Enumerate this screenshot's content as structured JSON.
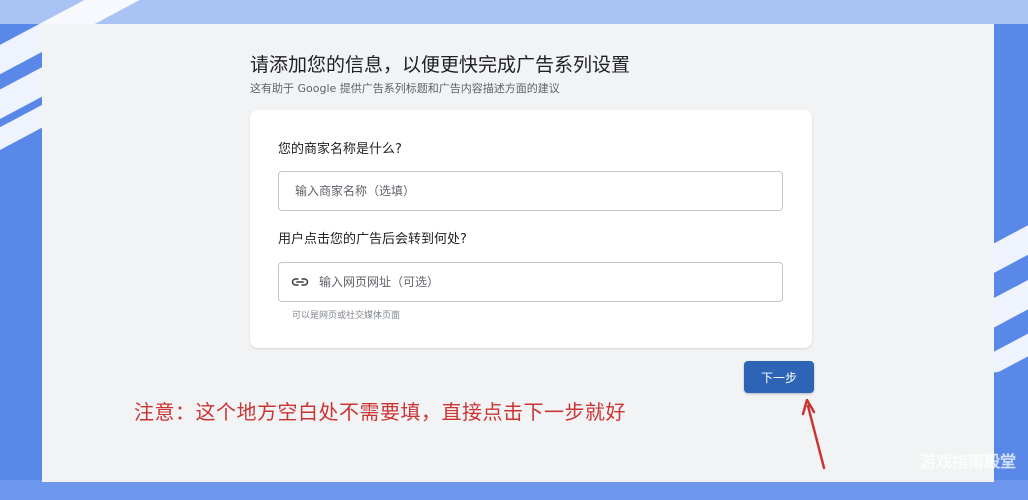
{
  "page": {
    "title": "请添加您的信息，以便更快完成广告系列设置",
    "subtitle": "这有助于 Google 提供广告系列标题和广告内容描述方面的建议"
  },
  "form": {
    "business_question": "您的商家名称是什么?",
    "business_placeholder": "输入商家名称（选填）",
    "url_question": "用户点击您的广告后会转到何处?",
    "url_placeholder": "输入网页网址（可选）",
    "url_hint": "可以是网页或社交媒体页面",
    "url_icon": "link-icon"
  },
  "actions": {
    "next_label": "下一步"
  },
  "annotation": {
    "note": "注意：这个地方空白处不需要填，直接点击下一步就好",
    "arrow_icon": "red-arrow-icon"
  },
  "watermark": "游戏指南殿堂",
  "colors": {
    "primary_button": "#2e64b6",
    "annotation_red": "#cc3333",
    "background_blue": "#5a88e8",
    "panel": "#f1f3f4"
  }
}
